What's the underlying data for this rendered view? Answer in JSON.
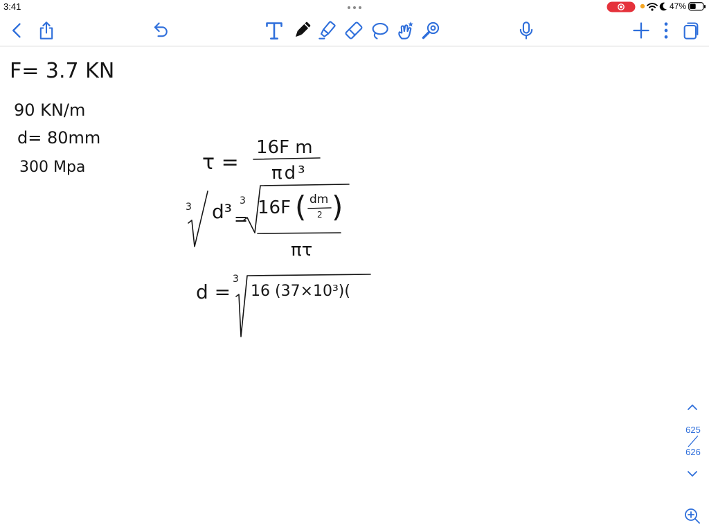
{
  "status_bar": {
    "time": "3:41",
    "battery_level": "47%",
    "battery_fill": 0.47,
    "icons": [
      "multitasking-dots-icon",
      "screen-recording-icon",
      "privacy-dot-icon",
      "wifi-icon",
      "do-not-disturb-moon-icon",
      "battery-icon"
    ]
  },
  "toolbar": {
    "left_icons": [
      "chevron-left-icon",
      "share-icon",
      "undo-icon"
    ],
    "tool_icons": [
      "text-tool-icon",
      "pen-icon",
      "highlighter-icon",
      "eraser-icon",
      "lasso-icon",
      "elements-icon",
      "laser-pointer-icon"
    ],
    "right_icons": [
      "microphone-icon",
      "plus-icon",
      "more-vertical-icon",
      "pages-icon"
    ],
    "selected_tool": "pen-icon"
  },
  "page": {
    "given": [
      "F= 3.7 KN",
      "90 KN/m",
      "d= 80mm",
      "300 Mpa"
    ],
    "eq1": {
      "lhs": "τ =",
      "numerator": "16F m",
      "denominator": "πd³"
    },
    "eq2": {
      "lhs_root_index": "3",
      "lhs_radicand": "d³",
      "equals": "=",
      "rhs_root_index": "3",
      "numerator": "16F",
      "open_paren": "(",
      "inner_numerator": "dm",
      "inner_denominator": "2",
      "close_paren": ")",
      "denominator": "πτ"
    },
    "eq3": {
      "lhs": "d =",
      "root_index": "3",
      "radicand": "16 (37×10³)("
    }
  },
  "page_nav": {
    "current_page": "625",
    "total_pages": "626"
  },
  "colors": {
    "accent": "#2f6fdb",
    "ink": "#161616",
    "record": "#e5323b",
    "privacy_dot": "#f5a623"
  }
}
